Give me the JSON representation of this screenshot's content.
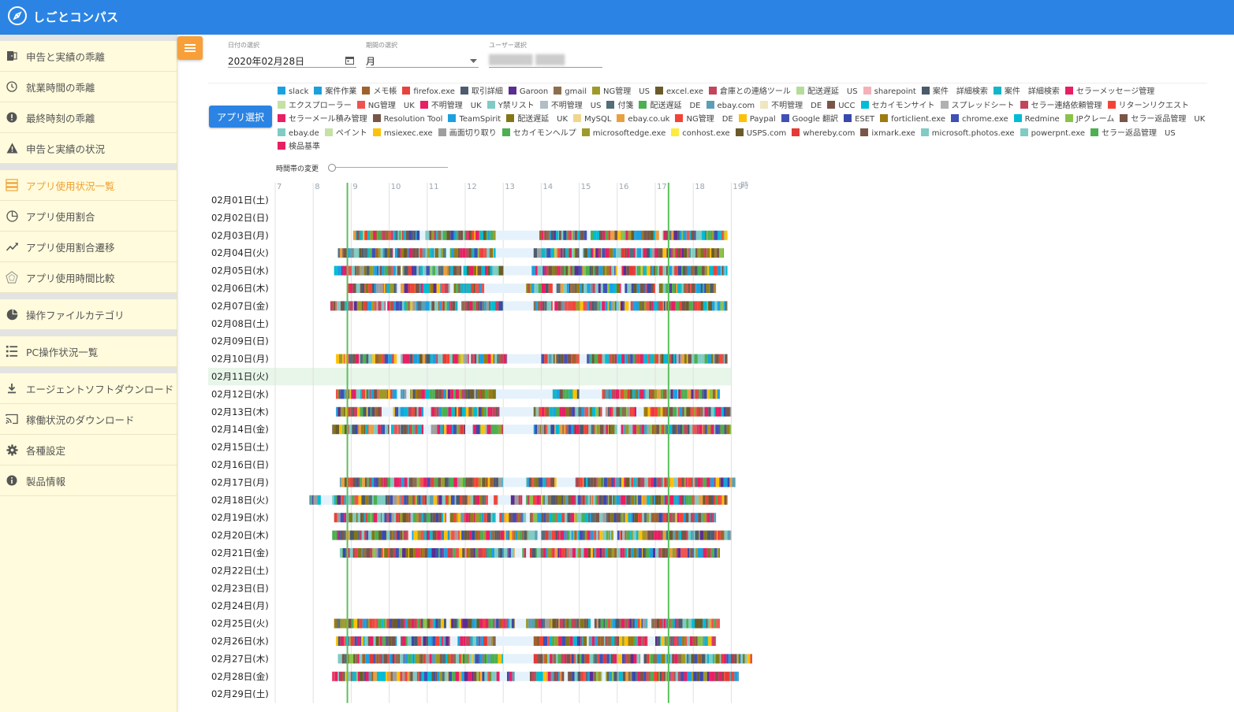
{
  "header": {
    "title": "しごとコンパス"
  },
  "sidebar": {
    "items": [
      {
        "label": "申告と実績の乖離",
        "icon": "door-icon"
      },
      {
        "label": "就業時間の乖離",
        "icon": "clock-icon"
      },
      {
        "label": "最終時刻の乖離",
        "icon": "alert-circle-icon"
      },
      {
        "label": "申告と実績の状況",
        "icon": "warning-icon"
      },
      {
        "label": "アプリ使用状況一覧",
        "icon": "list-chart-icon",
        "active": true
      },
      {
        "label": "アプリ使用割合",
        "icon": "pie-icon"
      },
      {
        "label": "アプリ使用割合遷移",
        "icon": "trend-icon"
      },
      {
        "label": "アプリ使用時間比較",
        "icon": "radar-icon"
      },
      {
        "label": "操作ファイルカテゴリ",
        "icon": "pie-filled-icon"
      },
      {
        "label": "PC操作状況一覧",
        "icon": "list-icon"
      },
      {
        "label": "エージェントソフトダウンロード",
        "icon": "download-icon"
      },
      {
        "label": "稼働状況のダウンロード",
        "icon": "cast-icon"
      },
      {
        "label": "各種設定",
        "icon": "gear-icon"
      },
      {
        "label": "製品情報",
        "icon": "info-icon"
      }
    ]
  },
  "filters": {
    "date": {
      "label": "日付の選択",
      "value": "2020年02月28日"
    },
    "period": {
      "label": "期間の選択",
      "value": "月"
    },
    "user": {
      "label": "ユーザー選択",
      "value": "██████ ████"
    }
  },
  "app_select_label": "アプリ選択",
  "slider_label": "時間帯の変更",
  "legend": [
    {
      "name": "slack",
      "color": "#1ba1e2"
    },
    {
      "name": "案件作業",
      "color": "#1aa0dc"
    },
    {
      "name": "メモ帳",
      "color": "#a0622d"
    },
    {
      "name": "firefox.exe",
      "color": "#e8423a"
    },
    {
      "name": "取引詳細",
      "color": "#4d5c6e"
    },
    {
      "name": "Garoon",
      "color": "#5c2d91"
    },
    {
      "name": "gmail",
      "color": "#8d6e4f"
    },
    {
      "name": "NG管理　US",
      "color": "#9e9a2a"
    },
    {
      "name": "excel.exe",
      "color": "#6b5b2a"
    },
    {
      "name": "倉庫との連絡ツール",
      "color": "#c2455c"
    },
    {
      "name": "配送遅延　US",
      "color": "#b5dd9a"
    },
    {
      "name": "sharepoint",
      "color": "#f4b1b8"
    },
    {
      "name": "案件　詳細検索",
      "color": "#4a5a6a"
    },
    {
      "name": "案件　詳細検索",
      "color": "#13b5c8"
    },
    {
      "name": "セラーメッセージ管理",
      "color": "#e91e63"
    },
    {
      "name": "エクスプローラー",
      "color": "#c5e1a5"
    },
    {
      "name": "NG管理　UK",
      "color": "#ef5350"
    },
    {
      "name": "不明管理　UK",
      "color": "#e91e63"
    },
    {
      "name": "Y禁リスト",
      "color": "#80cbc4"
    },
    {
      "name": "不明管理　US",
      "color": "#b0bec5"
    },
    {
      "name": "付箋",
      "color": "#546e7a"
    },
    {
      "name": "配送遅延　DE",
      "color": "#4caf50"
    },
    {
      "name": "ebay.com",
      "color": "#5a9fb5"
    },
    {
      "name": "不明管理　DE",
      "color": "#f0e6c0"
    },
    {
      "name": "UCC",
      "color": "#795548"
    },
    {
      "name": "セカイモンサイト",
      "color": "#00bcd4"
    },
    {
      "name": "スプレッドシート",
      "color": "#b0b0b0"
    },
    {
      "name": "セラー連絡依頼管理",
      "color": "#c2455c"
    },
    {
      "name": "リターンリクエスト",
      "color": "#f44336"
    },
    {
      "name": "セラーメール積み管理",
      "color": "#e91e63"
    },
    {
      "name": "Resolution Tool",
      "color": "#795548"
    },
    {
      "name": "TeamSpirit",
      "color": "#1ba1e2"
    },
    {
      "name": "配送遅延　UK",
      "color": "#827717"
    },
    {
      "name": "MySQL",
      "color": "#f0d58c"
    },
    {
      "name": "ebay.co.uk",
      "color": "#e8a040"
    },
    {
      "name": "NG管理　DE",
      "color": "#f44336"
    },
    {
      "name": "Paypal",
      "color": "#ffc107"
    },
    {
      "name": "Google 翻訳",
      "color": "#3f51b5"
    },
    {
      "name": "ESET",
      "color": "#3949ab"
    },
    {
      "name": "forticlient.exe",
      "color": "#9e7b0f"
    },
    {
      "name": "chrome.exe",
      "color": "#3f51b5"
    },
    {
      "name": "Redmine",
      "color": "#00bcd4"
    },
    {
      "name": "JPクレーム",
      "color": "#8bc34a"
    },
    {
      "name": "セラー返品管理　UK",
      "color": "#795548"
    },
    {
      "name": "ebay.de",
      "color": "#80cbc4"
    },
    {
      "name": "ペイント",
      "color": "#c5e1a5"
    },
    {
      "name": "msiexec.exe",
      "color": "#ffc107"
    },
    {
      "name": "画面切り取り",
      "color": "#9e9e9e"
    },
    {
      "name": "セカイモンヘルプ",
      "color": "#4caf50"
    },
    {
      "name": "microsoftedge.exe",
      "color": "#9e9a2a"
    },
    {
      "name": "conhost.exe",
      "color": "#ffeb3b"
    },
    {
      "name": "USPS.com",
      "color": "#6b5b2a"
    },
    {
      "name": "whereby.com",
      "color": "#e53935"
    },
    {
      "name": "ixmark.exe",
      "color": "#795548"
    },
    {
      "name": "microsoft.photos.exe",
      "color": "#80cbc4"
    },
    {
      "name": "powerpnt.exe",
      "color": "#80cbc4"
    },
    {
      "name": "セラー返品管理　US",
      "color": "#4caf50"
    },
    {
      "name": "検品基準",
      "color": "#e91e63"
    }
  ],
  "chart_data": {
    "type": "timeline",
    "hour_labels": [
      "7",
      "8",
      "9",
      "10",
      "11",
      "12",
      "13",
      "14",
      "15",
      "16",
      "17",
      "18",
      "19"
    ],
    "hour_unit": "時",
    "x_range": [
      7,
      19
    ],
    "reference_lines": [
      8.9,
      17.35
    ],
    "highlight_row": "02月11日(火)",
    "rows": [
      {
        "date": "02月01日(土)",
        "activity": []
      },
      {
        "date": "02月02日(日)",
        "activity": []
      },
      {
        "date": "02月03日(月)",
        "activity": [
          [
            9.05,
            10.8
          ],
          [
            10.95,
            12.8
          ],
          [
            13.95,
            15.2
          ],
          [
            15.3,
            16.1
          ],
          [
            16.1,
            17.1
          ],
          [
            17.2,
            18.9
          ]
        ]
      },
      {
        "date": "02月04日(火)",
        "activity": [
          [
            8.65,
            10.1
          ],
          [
            10.15,
            11.5
          ],
          [
            11.6,
            12.8
          ],
          [
            13.8,
            15.0
          ],
          [
            15.1,
            16.1
          ],
          [
            16.1,
            17.1
          ],
          [
            17.1,
            18.8
          ]
        ]
      },
      {
        "date": "02月05日(水)",
        "activity": [
          [
            8.55,
            10.3
          ],
          [
            10.35,
            11.9
          ],
          [
            11.95,
            13.0
          ],
          [
            13.75,
            14.6
          ],
          [
            14.6,
            16.0
          ],
          [
            16.1,
            17.1
          ],
          [
            17.1,
            18.9
          ]
        ]
      },
      {
        "date": "02月06日(木)",
        "activity": [
          [
            8.9,
            10.2
          ],
          [
            10.3,
            11.6
          ],
          [
            11.7,
            12.5
          ],
          [
            13.6,
            14.3
          ],
          [
            14.4,
            16.1
          ],
          [
            16.2,
            17.0
          ],
          [
            17.1,
            18.6
          ]
        ]
      },
      {
        "date": "02月07日(金)",
        "activity": [
          [
            8.45,
            9.9
          ],
          [
            9.95,
            11.8
          ],
          [
            11.9,
            13.0
          ],
          [
            13.8,
            14.3
          ],
          [
            14.35,
            16.3
          ],
          [
            16.35,
            17.1
          ],
          [
            17.1,
            18.9
          ]
        ]
      },
      {
        "date": "02月08日(土)",
        "activity": []
      },
      {
        "date": "02月09日(日)",
        "activity": []
      },
      {
        "date": "02月10日(月)",
        "activity": [
          [
            8.6,
            10.2
          ],
          [
            10.3,
            12.1
          ],
          [
            12.15,
            13.1
          ],
          [
            14.0,
            15.0
          ],
          [
            15.2,
            17.3
          ],
          [
            17.3,
            18.9
          ]
        ]
      },
      {
        "date": "02月11日(火)",
        "activity": []
      },
      {
        "date": "02月12日(水)",
        "activity": [
          [
            8.6,
            10.2
          ],
          [
            10.3,
            10.45
          ],
          [
            10.55,
            12.8
          ],
          [
            14.3,
            15.0
          ],
          [
            15.6,
            17.3
          ],
          [
            17.3,
            18.7
          ]
        ]
      },
      {
        "date": "02月13日(木)",
        "activity": [
          [
            8.6,
            9.8
          ],
          [
            10.1,
            10.9
          ],
          [
            11.1,
            12.9
          ],
          [
            13.8,
            15.6
          ],
          [
            15.7,
            16.5
          ],
          [
            16.7,
            17.3
          ],
          [
            17.3,
            19.0
          ]
        ]
      },
      {
        "date": "02月14日(金)",
        "activity": [
          [
            8.5,
            10.0
          ],
          [
            10.05,
            10.9
          ],
          [
            11.1,
            12.0
          ],
          [
            12.2,
            13.0
          ],
          [
            13.8,
            16.0
          ],
          [
            16.1,
            17.3
          ],
          [
            17.3,
            19.0
          ]
        ]
      },
      {
        "date": "02月15日(土)",
        "activity": []
      },
      {
        "date": "02月16日(日)",
        "activity": []
      },
      {
        "date": "02月17日(月)",
        "activity": [
          [
            8.7,
            13.0
          ],
          [
            13.6,
            14.4
          ],
          [
            14.9,
            17.2
          ],
          [
            17.2,
            19.1
          ]
        ]
      },
      {
        "date": "02月18日(火)",
        "activity": [
          [
            7.9,
            8.2
          ],
          [
            8.5,
            12.6
          ],
          [
            12.75,
            12.85
          ],
          [
            13.2,
            13.5
          ],
          [
            13.6,
            17.0
          ],
          [
            17.0,
            18.9
          ]
        ]
      },
      {
        "date": "02月19日(水)",
        "activity": [
          [
            8.55,
            11.5
          ],
          [
            11.6,
            12.8
          ],
          [
            12.9,
            13.6
          ],
          [
            13.7,
            17.3
          ],
          [
            17.3,
            18.6
          ]
        ]
      },
      {
        "date": "02月20日(木)",
        "activity": [
          [
            8.5,
            10.5
          ],
          [
            10.6,
            13.9
          ],
          [
            14.0,
            15.9
          ],
          [
            16.0,
            17.3
          ],
          [
            17.3,
            19.0
          ]
        ]
      },
      {
        "date": "02月21日(金)",
        "activity": [
          [
            8.7,
            13.3
          ],
          [
            13.5,
            13.6
          ],
          [
            13.7,
            17.0
          ],
          [
            17.0,
            18.7
          ]
        ]
      },
      {
        "date": "02月22日(土)",
        "activity": []
      },
      {
        "date": "02月23日(日)",
        "activity": []
      },
      {
        "date": "02月24日(月)",
        "activity": []
      },
      {
        "date": "02月25日(火)",
        "activity": [
          [
            8.55,
            11.5
          ],
          [
            11.6,
            13.3
          ],
          [
            13.6,
            15.3
          ],
          [
            15.4,
            16.8
          ],
          [
            16.9,
            17.3
          ],
          [
            17.3,
            18.7
          ]
        ]
      },
      {
        "date": "02月26日(水)",
        "activity": [
          [
            8.6,
            10.2
          ],
          [
            10.3,
            11.6
          ],
          [
            11.8,
            12.8
          ],
          [
            13.8,
            15.2
          ],
          [
            15.25,
            16.8
          ],
          [
            17.0,
            18.6
          ]
        ]
      },
      {
        "date": "02月27日(木)",
        "activity": [
          [
            8.65,
            13.0
          ],
          [
            13.8,
            16.6
          ],
          [
            16.7,
            17.3
          ],
          [
            17.3,
            19.6
          ]
        ]
      },
      {
        "date": "02月28日(金)",
        "activity": [
          [
            8.5,
            12.9
          ],
          [
            13.1,
            13.3
          ],
          [
            13.7,
            14.6
          ],
          [
            14.7,
            15.6
          ],
          [
            15.7,
            17.3
          ],
          [
            17.3,
            19.2
          ]
        ]
      },
      {
        "date": "02月29日(土)",
        "activity": []
      }
    ]
  }
}
